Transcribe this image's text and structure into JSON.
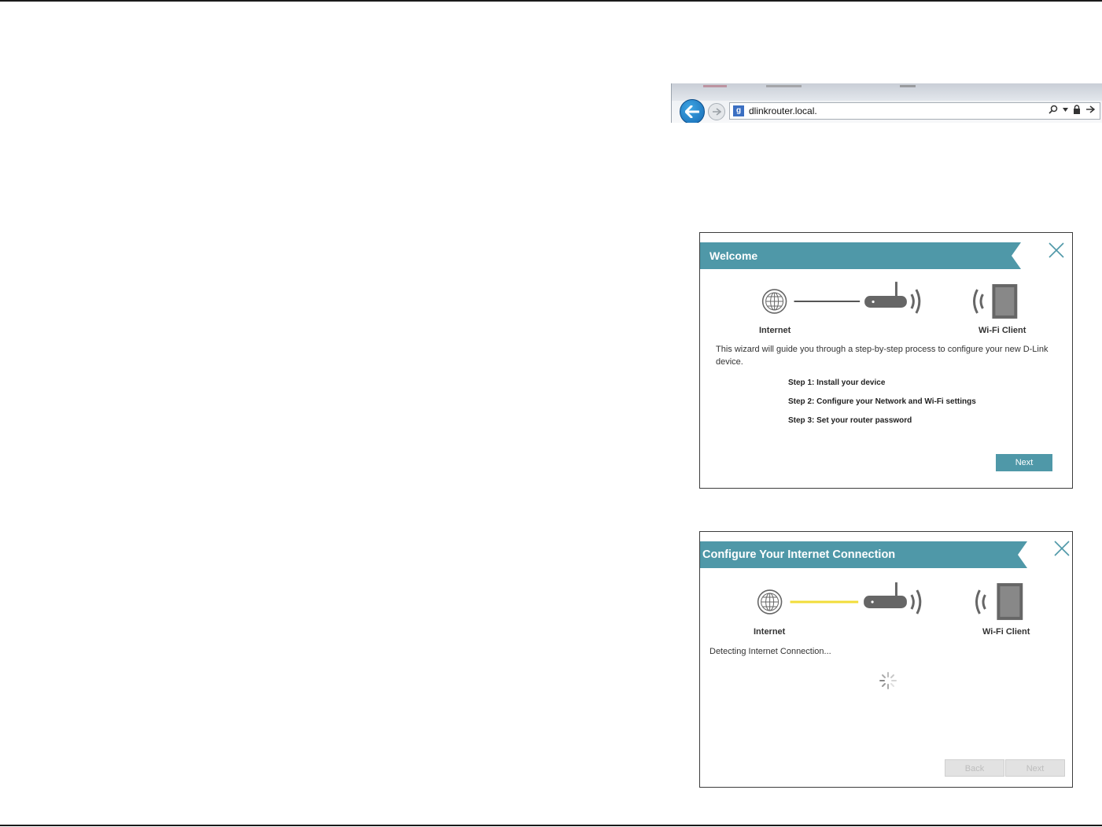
{
  "browser": {
    "url": "dlinkrouter.local.",
    "favicon_glyph": "g"
  },
  "welcome_dialog": {
    "title": "Welcome",
    "internet_label": "Internet",
    "client_label": "Wi-Fi Client",
    "description": "This wizard will guide you through a step-by-step process to configure your new D-Link device.",
    "steps": [
      {
        "prefix": "Step 1",
        "text": ": Install your device"
      },
      {
        "prefix": "Step 2",
        "text": ": Configure your Network and Wi-Fi settings"
      },
      {
        "prefix": "Step 3",
        "text": ": Set your router password"
      }
    ],
    "next_label": "Next",
    "link_color": "#555555"
  },
  "connection_dialog": {
    "title": "Configure Your Internet Connection",
    "internet_label": "Internet",
    "client_label": "Wi-Fi Client",
    "status": "Detecting Internet Connection...",
    "back_label": "Back",
    "next_label": "Next",
    "link_color": "#f2dd3a"
  },
  "colors": {
    "accent": "#4f98a8",
    "icon": "#666666"
  }
}
